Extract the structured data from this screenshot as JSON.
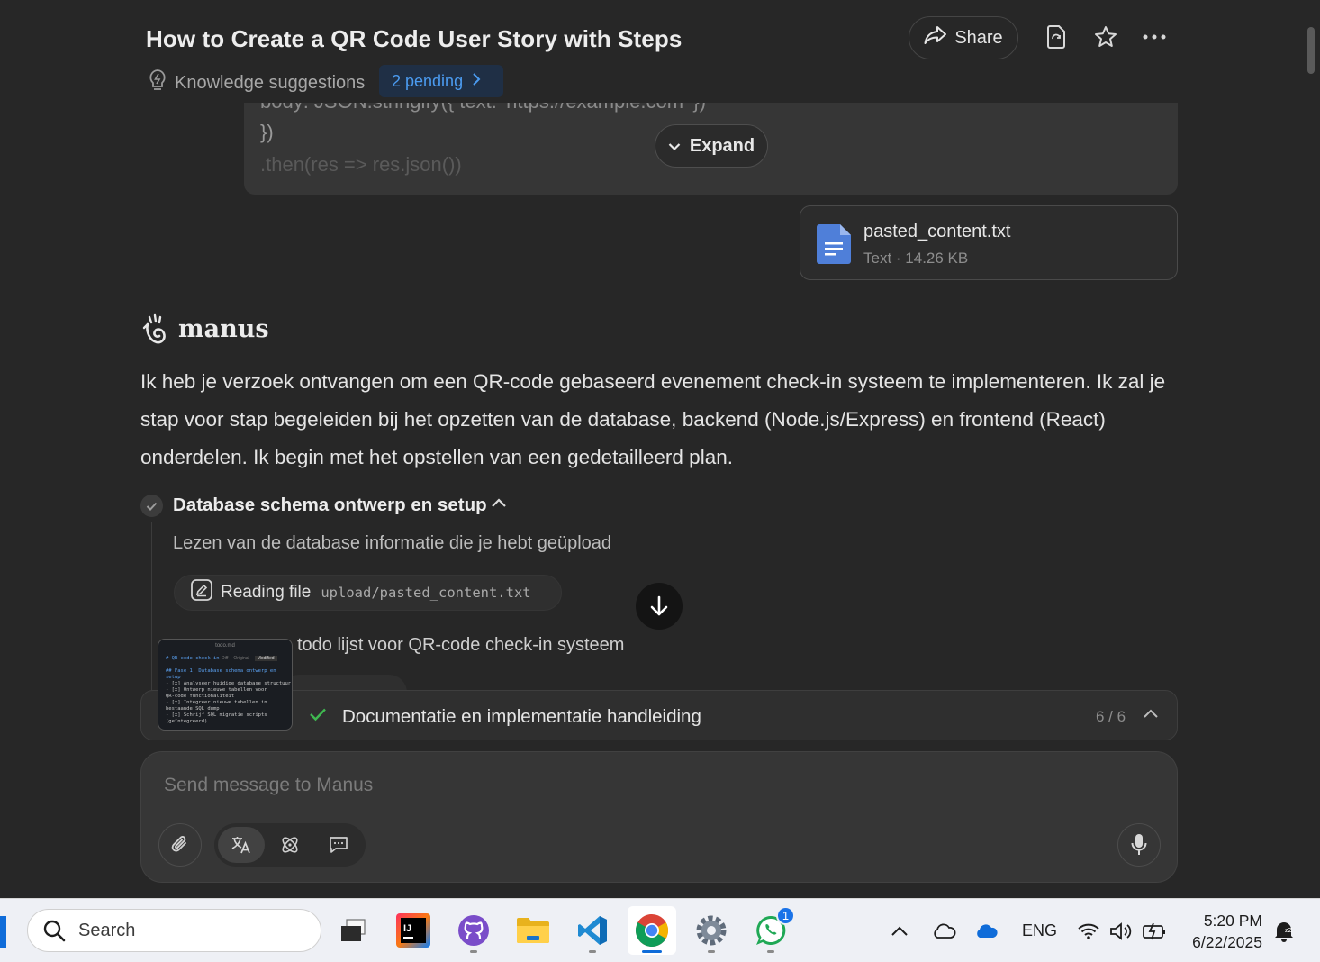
{
  "header": {
    "title": "How to Create a QR Code User Story with Steps",
    "share_label": "Share",
    "knowledge_label": "Knowledge suggestions",
    "pending_label": "2 pending"
  },
  "code_preview": {
    "line1": "body: JSON.stringify({ text: 'https://example.com' })",
    "line2": "})",
    "line3": ".then(res => res.json())",
    "expand_label": "Expand"
  },
  "attachment": {
    "name": "pasted_content.txt",
    "meta": "Text · 14.26 KB"
  },
  "assistant": {
    "name": "manus",
    "message": "Ik heb je verzoek ontvangen om een QR-code gebaseerd evenement check-in systeem te implementeren. Ik zal je stap voor stap begeleiden bij het opzetten van de database, backend (Node.js/Express) en frontend (React) onderdelen. Ik begin met het opstellen van een gedetailleerd plan."
  },
  "step": {
    "title": "Database schema ontwerp en setup",
    "description": "Lezen van de database informatie die je hebt geüpload",
    "action_label": "Reading file",
    "action_path": "upload/pasted_content.txt",
    "next_text": "todo lijst voor QR-code check-in systeem"
  },
  "thumbnail": {
    "filename": "todo.md",
    "tabs": [
      "Diff",
      "Original",
      "Modified"
    ],
    "lines": [
      "# QR-code check-in",
      "",
      "## Fase 1: Database schema ontwerp en",
      "setup",
      "- [x] Analyseer huidige database structuur",
      "- [x] Ontwerp nieuwe tabellen voor",
      "QR-code functionaliteit",
      "- [x] Integreer nieuwe tabellen in",
      "bestaande SQL dump",
      "- [x] Schrijf SQL migratie scripts",
      "(geïntegreerd)"
    ]
  },
  "progress": {
    "label": "Documentatie en implementatie handleiding",
    "count": "6 / 6"
  },
  "composer": {
    "placeholder": "Send message to Manus"
  },
  "taskbar": {
    "search_label": "Search",
    "language": "ENG",
    "time": "5:20 PM",
    "date": "6/22/2025",
    "whatsapp_badge": "1"
  },
  "colors": {
    "background": "#272727",
    "accent_blue": "#4b9bf0",
    "check_green": "#3fb950"
  }
}
